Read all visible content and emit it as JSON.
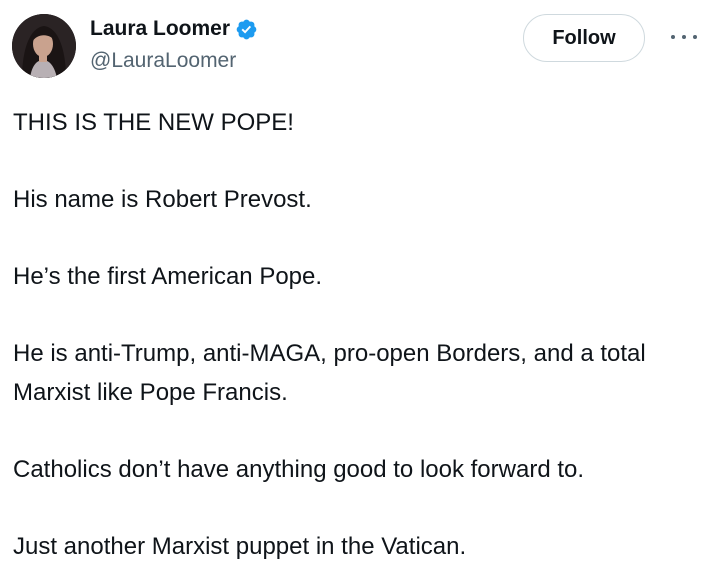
{
  "author": {
    "display_name": "Laura Loomer",
    "handle": "@LauraLoomer",
    "verified": true,
    "avatar_icon": "profile-photo"
  },
  "actions": {
    "follow_label": "Follow",
    "more_icon": "more-options-icon"
  },
  "tweet": {
    "paragraphs": [
      "THIS IS THE NEW POPE!",
      "His name is Robert Prevost.",
      "He’s the first American Pope.",
      "He is anti-Trump, anti-MAGA, pro-open Borders, and a total Marxist like Pope Francis.",
      "Catholics don’t have anything good to look forward to.",
      "Just another Marxist puppet in the Vatican."
    ]
  },
  "colors": {
    "text": "#0f1419",
    "secondary_text": "#536471",
    "verified_blue": "#1d9bf0",
    "button_border": "#cfd9de"
  }
}
